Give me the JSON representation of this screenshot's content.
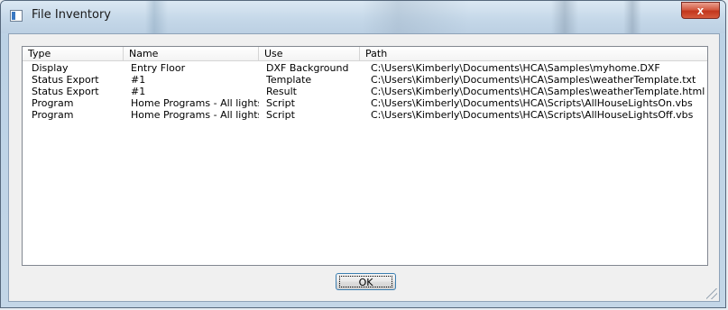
{
  "window": {
    "title": "File Inventory",
    "close_label": "x"
  },
  "list": {
    "columns": [
      "Type",
      "Name",
      "Use",
      "Path"
    ],
    "rows": [
      [
        "Display",
        "Entry Floor",
        "DXF Background",
        "C:\\Users\\Kimberly\\Documents\\HCA\\Samples\\myhome.DXF"
      ],
      [
        "Status Export",
        "#1",
        "Template",
        "C:\\Users\\Kimberly\\Documents\\HCA\\Samples\\weatherTemplate.txt"
      ],
      [
        "Status Export",
        "#1",
        "Result",
        "C:\\Users\\Kimberly\\Documents\\HCA\\Samples\\weatherTemplate.html"
      ],
      [
        "Program",
        "Home Programs - All lights",
        "Script",
        "C:\\Users\\Kimberly\\Documents\\HCA\\Scripts\\AllHouseLightsOn.vbs"
      ],
      [
        "Program",
        "Home Programs - All lights",
        "Script",
        "C:\\Users\\Kimberly\\Documents\\HCA\\Scripts\\AllHouseLightsOff.vbs"
      ]
    ]
  },
  "buttons": {
    "ok_label": "OK"
  },
  "icons": {
    "app": "window-app-icon",
    "close": "close-icon",
    "resize": "resize-grip-icon"
  }
}
